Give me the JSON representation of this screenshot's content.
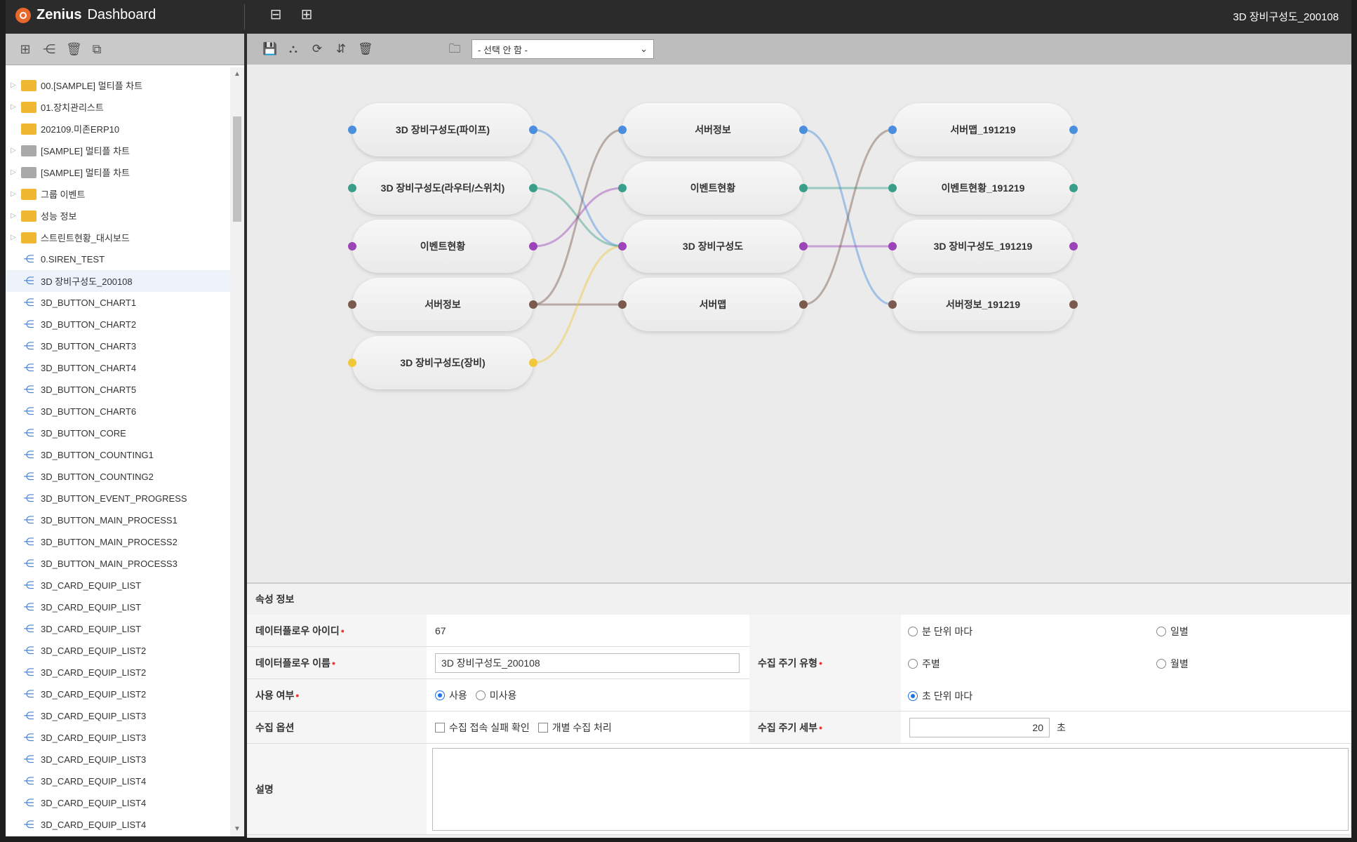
{
  "app": {
    "name_bold": "Zenius",
    "name_rest": "Dashboard",
    "current_title": "3D 장비구성도_200108"
  },
  "left_toolbar": {
    "icons": [
      "new-folder-icon",
      "tree-add-icon",
      "delete-icon",
      "copy-icon"
    ]
  },
  "tree": {
    "items": [
      {
        "label": "00.[SAMPLE] 멀티플 차트",
        "type": "folder",
        "expand": true
      },
      {
        "label": "01.장치관리스트",
        "type": "folder",
        "expand": true
      },
      {
        "label": "202109.미존ERP10",
        "type": "folder",
        "expand": false
      },
      {
        "label": "[SAMPLE] 멀티플 차트",
        "type": "folder-gray",
        "expand": true
      },
      {
        "label": "[SAMPLE] 멀티플 차트",
        "type": "folder-gray",
        "expand": true
      },
      {
        "label": "그룹 이벤트",
        "type": "folder",
        "expand": true
      },
      {
        "label": "성능 정보",
        "type": "folder",
        "expand": true
      },
      {
        "label": "스트린트현황_대시보드",
        "type": "folder",
        "expand": true
      },
      {
        "label": "0.SIREN_TEST",
        "type": "flow"
      },
      {
        "label": "3D 장비구성도_200108",
        "type": "flow",
        "selected": true
      },
      {
        "label": "3D_BUTTON_CHART1",
        "type": "flow"
      },
      {
        "label": "3D_BUTTON_CHART2",
        "type": "flow"
      },
      {
        "label": "3D_BUTTON_CHART3",
        "type": "flow"
      },
      {
        "label": "3D_BUTTON_CHART4",
        "type": "flow"
      },
      {
        "label": "3D_BUTTON_CHART5",
        "type": "flow"
      },
      {
        "label": "3D_BUTTON_CHART6",
        "type": "flow"
      },
      {
        "label": "3D_BUTTON_CORE",
        "type": "flow"
      },
      {
        "label": "3D_BUTTON_COUNTING1",
        "type": "flow"
      },
      {
        "label": "3D_BUTTON_COUNTING2",
        "type": "flow"
      },
      {
        "label": "3D_BUTTON_EVENT_PROGRESS",
        "type": "flow"
      },
      {
        "label": "3D_BUTTON_MAIN_PROCESS1",
        "type": "flow"
      },
      {
        "label": "3D_BUTTON_MAIN_PROCESS2",
        "type": "flow"
      },
      {
        "label": "3D_BUTTON_MAIN_PROCESS3",
        "type": "flow"
      },
      {
        "label": "3D_CARD_EQUIP_LIST",
        "type": "flow"
      },
      {
        "label": "3D_CARD_EQUIP_LIST",
        "type": "flow"
      },
      {
        "label": "3D_CARD_EQUIP_LIST",
        "type": "flow"
      },
      {
        "label": "3D_CARD_EQUIP_LIST2",
        "type": "flow"
      },
      {
        "label": "3D_CARD_EQUIP_LIST2",
        "type": "flow"
      },
      {
        "label": "3D_CARD_EQUIP_LIST2",
        "type": "flow"
      },
      {
        "label": "3D_CARD_EQUIP_LIST3",
        "type": "flow"
      },
      {
        "label": "3D_CARD_EQUIP_LIST3",
        "type": "flow"
      },
      {
        "label": "3D_CARD_EQUIP_LIST3",
        "type": "flow"
      },
      {
        "label": "3D_CARD_EQUIP_LIST4",
        "type": "flow"
      },
      {
        "label": "3D_CARD_EQUIP_LIST4",
        "type": "flow"
      },
      {
        "label": "3D_CARD_EQUIP_LIST4",
        "type": "flow"
      }
    ]
  },
  "main_toolbar": {
    "icons": [
      "save-icon",
      "layout-icon",
      "refresh-icon",
      "align-icon",
      "delete-icon",
      "folder-icon"
    ],
    "select_value": "- 선택 안 함 -"
  },
  "flow": {
    "col1": [
      "3D 장비구성도(파이프)",
      "3D 장비구성도(라우터/스위치)",
      "이벤트현황",
      "서버정보",
      "3D 장비구성도(장비)"
    ],
    "col2": [
      "서버정보",
      "이벤트현황",
      "3D 장비구성도",
      "서버맵"
    ],
    "col3": [
      "서버맵_191219",
      "이벤트현황_191219",
      "3D 장비구성도_191219",
      "서버정보_191219"
    ],
    "colors": [
      "#4a8fde",
      "#3a9e8a",
      "#9c44b8",
      "#7a5a4e",
      "#f0c83a"
    ]
  },
  "props": {
    "title": "속성 정보",
    "id_label": "데이터플로우 아이디",
    "id_value": "67",
    "name_label": "데이터플로우 이름",
    "name_value": "3D 장비구성도_200108",
    "use_label": "사용 여부",
    "use_yes": "사용",
    "use_no": "미사용",
    "option_label": "수집 옵션",
    "option_a": "수집 접속 실패 확인",
    "option_b": "개별 수집 처리",
    "cycle_type_label": "수집 주기 유형",
    "cycle_minute": "분 단위 마다",
    "cycle_daily": "일별",
    "cycle_weekly": "주별",
    "cycle_monthly": "월별",
    "cycle_second": "초 단위 마다",
    "cycle_detail_label": "수집 주기 세부",
    "cycle_detail_value": "20",
    "cycle_detail_unit": "초",
    "desc_label": "설명"
  }
}
